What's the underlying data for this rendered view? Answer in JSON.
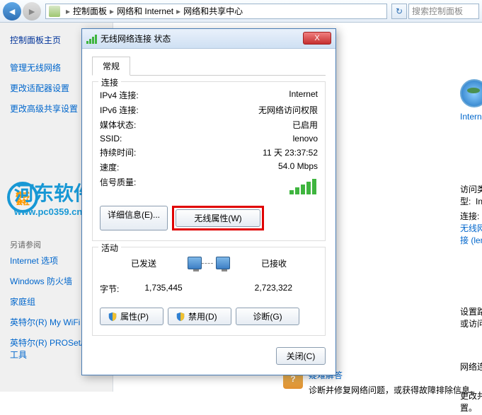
{
  "toolbar": {
    "breadcrumb": {
      "item1": "控制面板",
      "item2": "网络和 Internet",
      "item3": "网络和共享中心"
    },
    "search_placeholder": "搜索控制面板"
  },
  "sidebar": {
    "home": "控制面板主页",
    "links": [
      "管理无线网络",
      "更改适配器设置",
      "更改高级共享设置"
    ],
    "see_also_heading": "另请参阅",
    "see_also": [
      "Internet 选项",
      "Windows 防火墙",
      "家庭组",
      "英特尔(R) My WiFi 技术",
      "英特尔(R) PROSet/无线工具"
    ]
  },
  "right": {
    "globe_label": "Internet",
    "access_type_lbl": "访问类型:",
    "access_type_val": "Internet",
    "connections_lbl": "连接:",
    "connections_val": "无线网络连接 (leno",
    "router_text": "设置路由器或访问点。",
    "net_conn_text": "网络连接。",
    "change_text": "更改共享设置。"
  },
  "help": {
    "title": "疑难解答",
    "desc": "诊断并修复网络问题，或获得故障排除信息。"
  },
  "dialog": {
    "title": "无线网络连接 状态",
    "close": "X",
    "tab_general": "常规",
    "group_conn": "连接",
    "rows": {
      "ipv4_lbl": "IPv4 连接:",
      "ipv4_val": "Internet",
      "ipv6_lbl": "IPv6 连接:",
      "ipv6_val": "无网络访问权限",
      "media_lbl": "媒体状态:",
      "media_val": "已启用",
      "ssid_lbl": "SSID:",
      "ssid_val": "lenovo",
      "duration_lbl": "持续时间:",
      "duration_val": "11 天 23:37:52",
      "speed_lbl": "速度:",
      "speed_val": "54.0 Mbps",
      "signal_lbl": "信号质量:"
    },
    "btn_details": "详细信息(E)...",
    "btn_wireless": "无线属性(W)",
    "group_activity": "活动",
    "sent_lbl": "已发送",
    "recv_lbl": "已接收",
    "bytes_lbl": "字节:",
    "bytes_sent": "1,735,445",
    "bytes_recv": "2,723,322",
    "btn_props": "属性(P)",
    "btn_disable": "禁用(D)",
    "btn_diag": "诊断(G)",
    "btn_close": "关闭(C)"
  },
  "watermark": {
    "text": "河东软件园",
    "url": "www.pc0359.cn"
  }
}
